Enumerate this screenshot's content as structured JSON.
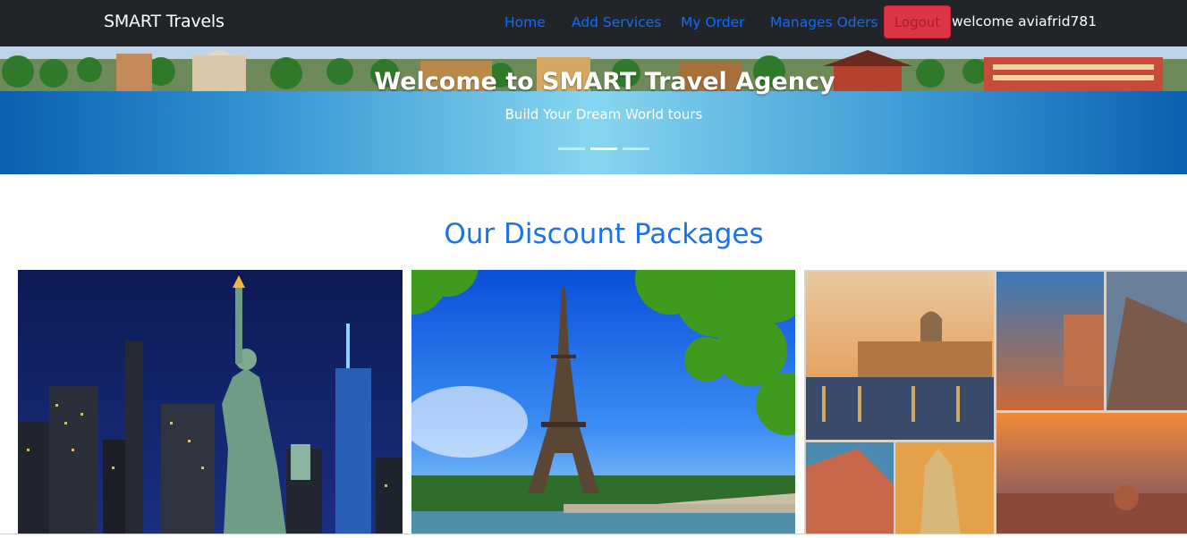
{
  "navbar": {
    "brand": "SMART Travels",
    "links": [
      "Home",
      "Add Services",
      "My Order",
      "Manages Oders"
    ],
    "logout_label": "Logout",
    "welcome_text": "welcome aviafrid781"
  },
  "hero": {
    "title": "Welcome to SMART Travel Agency",
    "subtitle": "Build Your Dream World tours",
    "indicators": 3,
    "active_indicator": 2
  },
  "packages": {
    "title": "Our Discount Packages",
    "cards": [
      {
        "image": "new-york-statue-of-liberty-night"
      },
      {
        "image": "paris-eiffel-tower"
      },
      {
        "image": "italy-collage"
      }
    ]
  },
  "colors": {
    "navbar_bg": "#212529",
    "link": "#0d6efd",
    "logout_bg": "#dc3545",
    "heading": "#1a73e8"
  }
}
